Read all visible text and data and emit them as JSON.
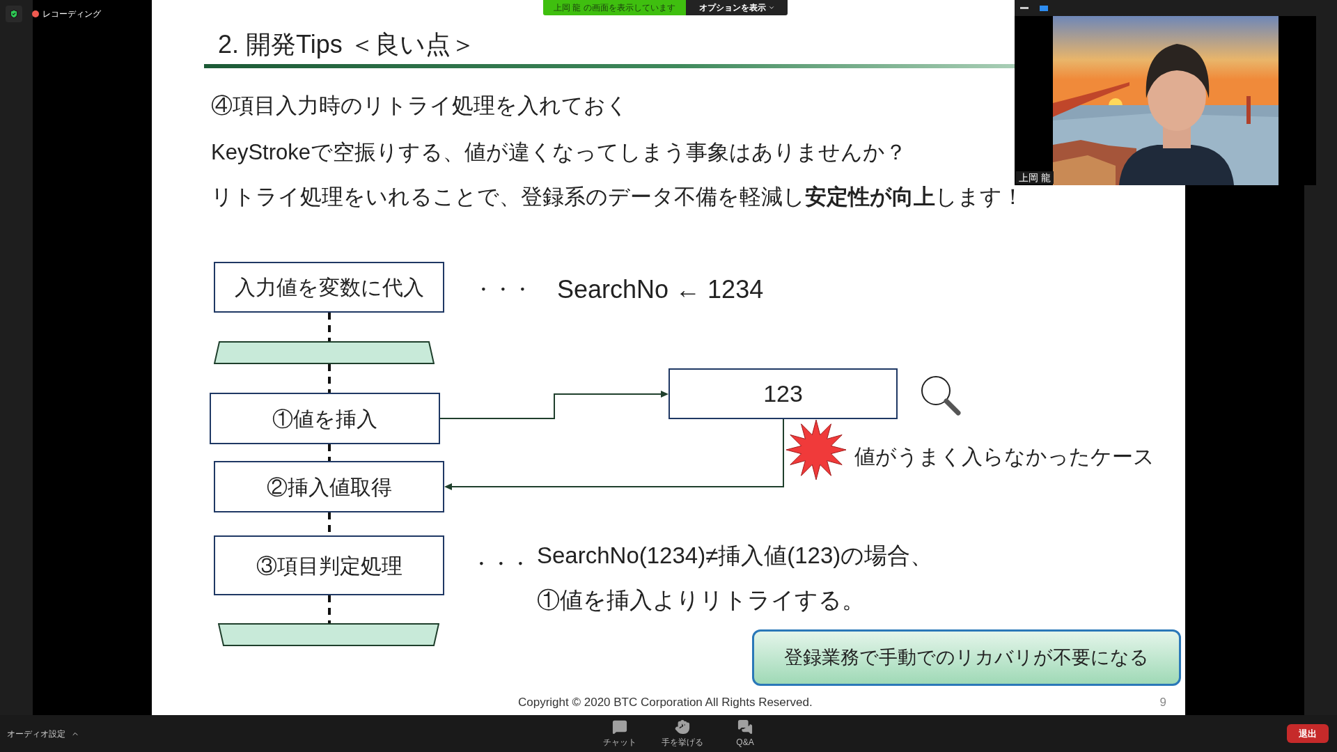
{
  "top_bar": {
    "recording": "レコーディング",
    "share_banner": "上岡 龍 の画面を表示しています",
    "options_button": "オプションを表示"
  },
  "slide": {
    "title": "2. 開発Tips ＜良い点＞",
    "heading": "④項目入力時のリトライ処理を入れておく",
    "lines": [
      "KeyStrokeで空振りする、値が違くなってしまう事象はありませんか？",
      "リトライ処理をいれることで、登録系のデータ不備を軽減し**安定性が向上**します！"
    ],
    "flowchart": {
      "steps": [
        {
          "kind": "process",
          "label": "入力値を変数に代入"
        },
        {
          "kind": "loop_start"
        },
        {
          "kind": "process",
          "label": "①値を挿入"
        },
        {
          "kind": "process",
          "label": "②挿入値取得"
        },
        {
          "kind": "process",
          "label": "③項目判定処理"
        },
        {
          "kind": "loop_end"
        }
      ],
      "assign_note": {
        "ellipsis": "・・・",
        "text": "SearchNo ← 1234"
      },
      "input_box": "123",
      "failure_note": "値がうまく入らなかったケース",
      "judge_note": {
        "ellipsis": "・・・",
        "lines": [
          "SearchNo(1234)≠挿入値(123)の場合、",
          "①値を挿入よりリトライする。"
        ]
      },
      "result": "登録業務で手動でのリカバリが不要になる"
    },
    "footer": "Copyright © 2020 BTC Corporation All Rights Reserved.",
    "page_number": "9"
  },
  "video": {
    "name": "上岡 龍"
  },
  "bottom_bar": {
    "audio_settings": "オーディオ設定",
    "controls": [
      {
        "kind": "chat",
        "label": "チャット"
      },
      {
        "kind": "hand",
        "label": "手を挙げる"
      },
      {
        "kind": "qa",
        "label": "Q&A"
      }
    ],
    "leave_button": "退出"
  }
}
